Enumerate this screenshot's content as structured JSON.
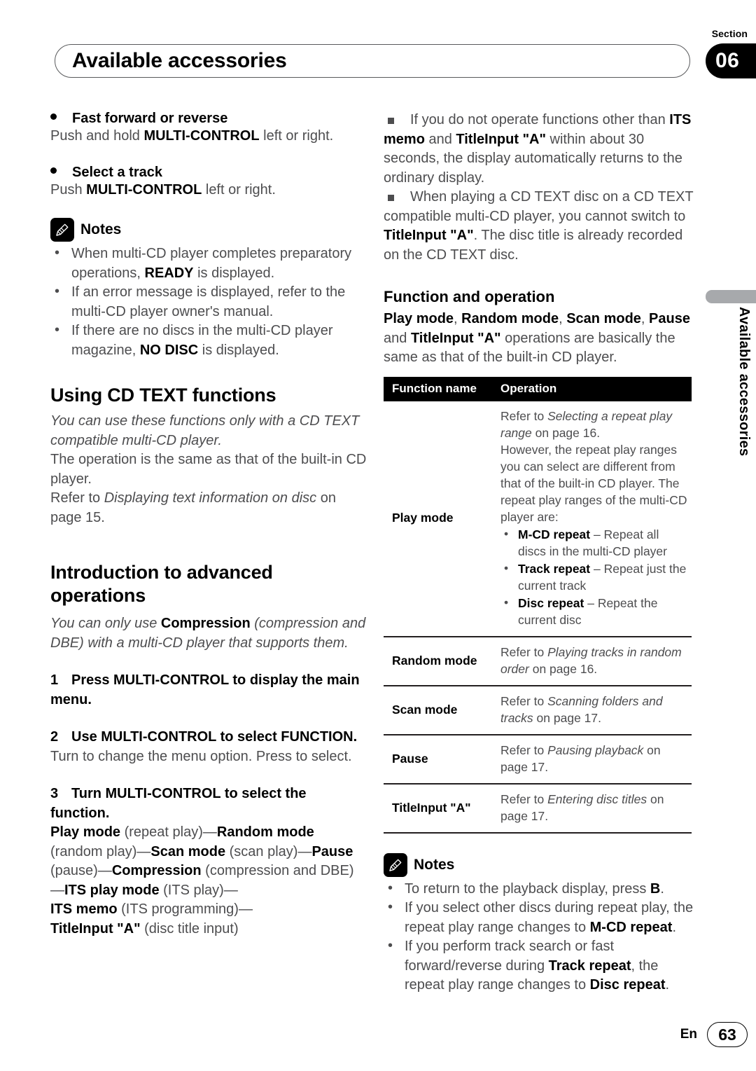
{
  "header": {
    "section_label": "Section",
    "section_number": "06",
    "title": "Available accessories"
  },
  "side_tab": {
    "text": "Available accessories"
  },
  "footer": {
    "language": "En",
    "page_number": "63"
  },
  "left_column": {
    "sub1": {
      "heading": "Fast forward or reverse",
      "body_pre": "Push and hold ",
      "body_bold": "MULTI-CONTROL",
      "body_post": " left or right."
    },
    "sub2": {
      "heading": "Select a track",
      "body_pre": "Push ",
      "body_bold": "MULTI-CONTROL",
      "body_post": " left or right."
    },
    "notes": {
      "label": "Notes",
      "items": [
        {
          "a": "When multi-CD player completes preparatory operations, ",
          "b": "READY",
          "c": " is displayed."
        },
        {
          "a": "If an error message is displayed, refer to the multi-CD player owner's manual.",
          "b": "",
          "c": ""
        },
        {
          "a": "If there are no discs in the multi-CD player magazine, ",
          "b": "NO DISC",
          "c": " is displayed."
        }
      ]
    },
    "cdtext": {
      "heading": "Using CD TEXT functions",
      "italic_intro": "You can use these functions only with a CD TEXT compatible multi-CD player.",
      "para1": "The operation is the same as that of the built-in CD player.",
      "para2_pre": "Refer to ",
      "para2_italic": "Displaying text information on disc",
      "para2_post": " on page 15."
    },
    "intro_adv": {
      "heading": "Introduction to advanced operations",
      "italic_pre": "You can only use ",
      "italic_bold": "Compression",
      "italic_post": " (compression and DBE) with a multi-CD player that supports them.",
      "steps": [
        {
          "num": "1",
          "text": "Press MULTI-CONTROL to display the main menu.",
          "detail": ""
        },
        {
          "num": "2",
          "text": "Use MULTI-CONTROL to select FUNCTION.",
          "detail": "Turn to change the menu option. Press to select."
        },
        {
          "num": "3",
          "text": "Turn MULTI-CONTROL to select the function.",
          "detail": ""
        }
      ],
      "function_chain": [
        {
          "bold": "Play mode",
          "plain": " (repeat play)—"
        },
        {
          "bold": "Random mode",
          "plain": " (random play)—"
        },
        {
          "bold": "Scan mode",
          "plain": " (scan play)—"
        },
        {
          "bold": "Pause",
          "plain": " (pause)—"
        },
        {
          "bold": "Compression",
          "plain": " (compression and DBE)—"
        },
        {
          "bold": "ITS play mode",
          "plain": " (ITS play)—"
        },
        {
          "bold": "ITS memo",
          "plain": " (ITS programming)—"
        },
        {
          "bold": "TitleInput \"A\"",
          "plain": " (disc title input)"
        }
      ]
    }
  },
  "right_column": {
    "top_notes": [
      {
        "p1": "If you do not operate functions other than ",
        "b1": "ITS memo",
        "p2": " and ",
        "b2": "TitleInput \"A\"",
        "p3": " within about 30 seconds, the display automatically returns to the ordinary display."
      },
      {
        "p1": "When playing a CD TEXT disc on a CD TEXT compatible multi-CD player, you cannot switch to ",
        "b1": "TitleInput \"A\"",
        "p2": ". The disc title is already recorded on the CD TEXT disc.",
        "b2": "",
        "p3": ""
      }
    ],
    "func_op": {
      "heading": "Function and operation",
      "lead_parts": [
        {
          "bold": "Play mode",
          "plain": ", "
        },
        {
          "bold": "Random mode",
          "plain": ", "
        },
        {
          "bold": "Scan mode",
          "plain": ", "
        },
        {
          "bold": "Pause",
          "plain": " and "
        },
        {
          "bold": "TitleInput \"A\"",
          "plain": " operations are basically the same as that of the built-in CD player."
        }
      ]
    },
    "table": {
      "columns": [
        "Function name",
        "Operation"
      ],
      "rows": [
        {
          "name": "Play mode",
          "op_pre": "Refer to ",
          "op_italic": "Selecting a repeat play range",
          "op_post": " on page 16.",
          "op_extra": "However, the repeat play ranges you can select are different from that of the built-in CD player. The repeat play ranges of the multi-CD player are:",
          "bullets": [
            {
              "bold": "M-CD repeat",
              "plain": " – Repeat all discs in the multi-CD player"
            },
            {
              "bold": "Track repeat",
              "plain": " – Repeat just the current track"
            },
            {
              "bold": "Disc repeat",
              "plain": " – Repeat the current disc"
            }
          ]
        },
        {
          "name": "Random mode",
          "op_pre": "Refer to ",
          "op_italic": "Playing tracks in random order",
          "op_post": " on page 16.",
          "op_extra": "",
          "bullets": []
        },
        {
          "name": "Scan mode",
          "op_pre": "Refer to ",
          "op_italic": "Scanning folders and tracks",
          "op_post": " on page 17.",
          "op_extra": "",
          "bullets": []
        },
        {
          "name": "Pause",
          "op_pre": "Refer to ",
          "op_italic": "Pausing playback",
          "op_post": " on page 17.",
          "op_extra": "",
          "bullets": []
        },
        {
          "name": "TitleInput \"A\"",
          "op_pre": "Refer to ",
          "op_italic": "Entering disc titles",
          "op_post": " on page 17.",
          "op_extra": "",
          "bullets": []
        }
      ]
    },
    "bottom_notes": {
      "label": "Notes",
      "items": [
        {
          "a": "To return to the playback display, press ",
          "b": "B",
          "c": "."
        },
        {
          "a": "If you select other discs during repeat play, the repeat play range changes to ",
          "b": "M-CD repeat",
          "c": "."
        },
        {
          "a": "If you perform track search or fast forward/reverse during ",
          "b": "Track repeat",
          "c": ", the repeat play range changes to ",
          "b2": "Disc repeat",
          "c2": "."
        }
      ]
    }
  }
}
